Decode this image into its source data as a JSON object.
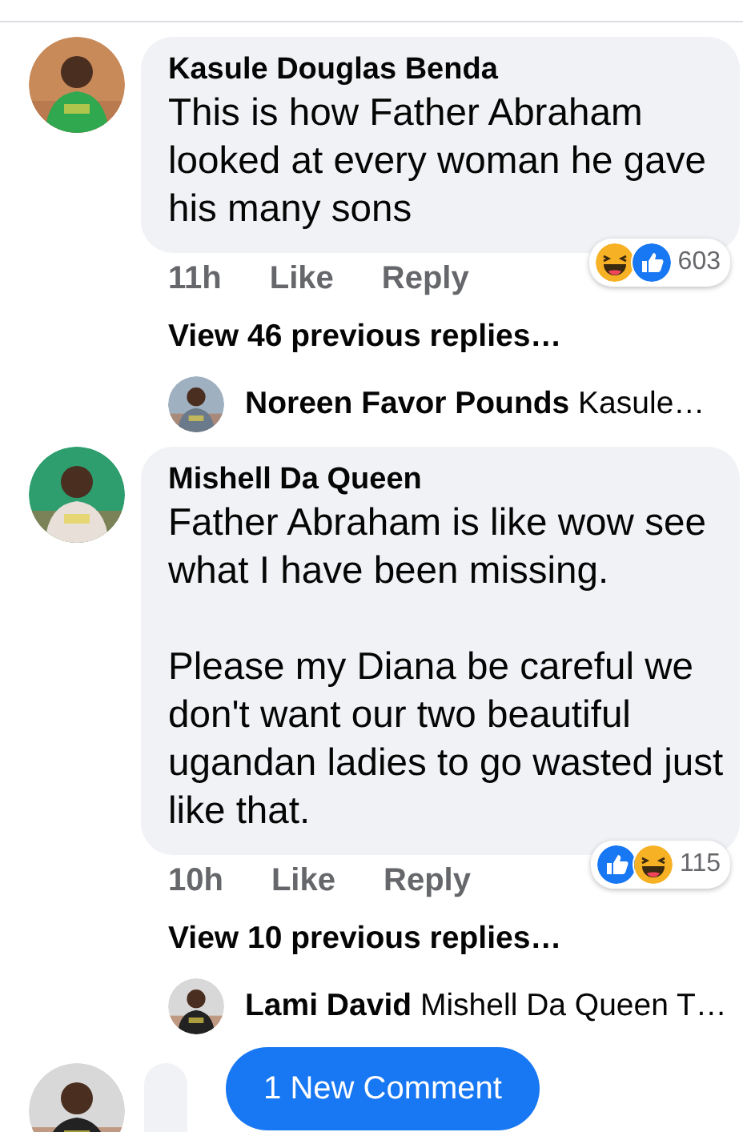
{
  "comments": [
    {
      "avatar": {
        "kind": "picture"
      },
      "name": "Kasule Douglas Benda",
      "paragraphs": [
        "This is how Father Abraham looked at every woman he gave his many sons"
      ],
      "time": "11h",
      "actions": [
        "Like",
        "Reply"
      ],
      "reactions": [
        {
          "kind": "haha"
        },
        {
          "kind": "like"
        }
      ],
      "reaction_count": "603",
      "view_replies": "View 46 previous replies…",
      "reply_preview": {
        "name": "Noreen Favor Pounds",
        "text": "Kasule…"
      }
    },
    {
      "avatar": {
        "kind": "picture"
      },
      "name": "Mishell Da Queen",
      "paragraphs": [
        "Father Abraham is like wow see what I have been missing.",
        "Please my Diana be careful we don't want our two beautiful ugandan ladies to go wasted just like that."
      ],
      "time": "10h",
      "actions": [
        "Like",
        "Reply"
      ],
      "reactions": [
        {
          "kind": "like"
        },
        {
          "kind": "haha"
        }
      ],
      "reaction_count": "115",
      "view_replies": "View 10 previous replies…",
      "reply_preview": {
        "name": "Lami David",
        "text": "Mishell Da Queen T…"
      }
    }
  ],
  "partial_comment": {
    "avatar": {
      "kind": "picture"
    }
  },
  "new_comment_button": "1 New Comment"
}
